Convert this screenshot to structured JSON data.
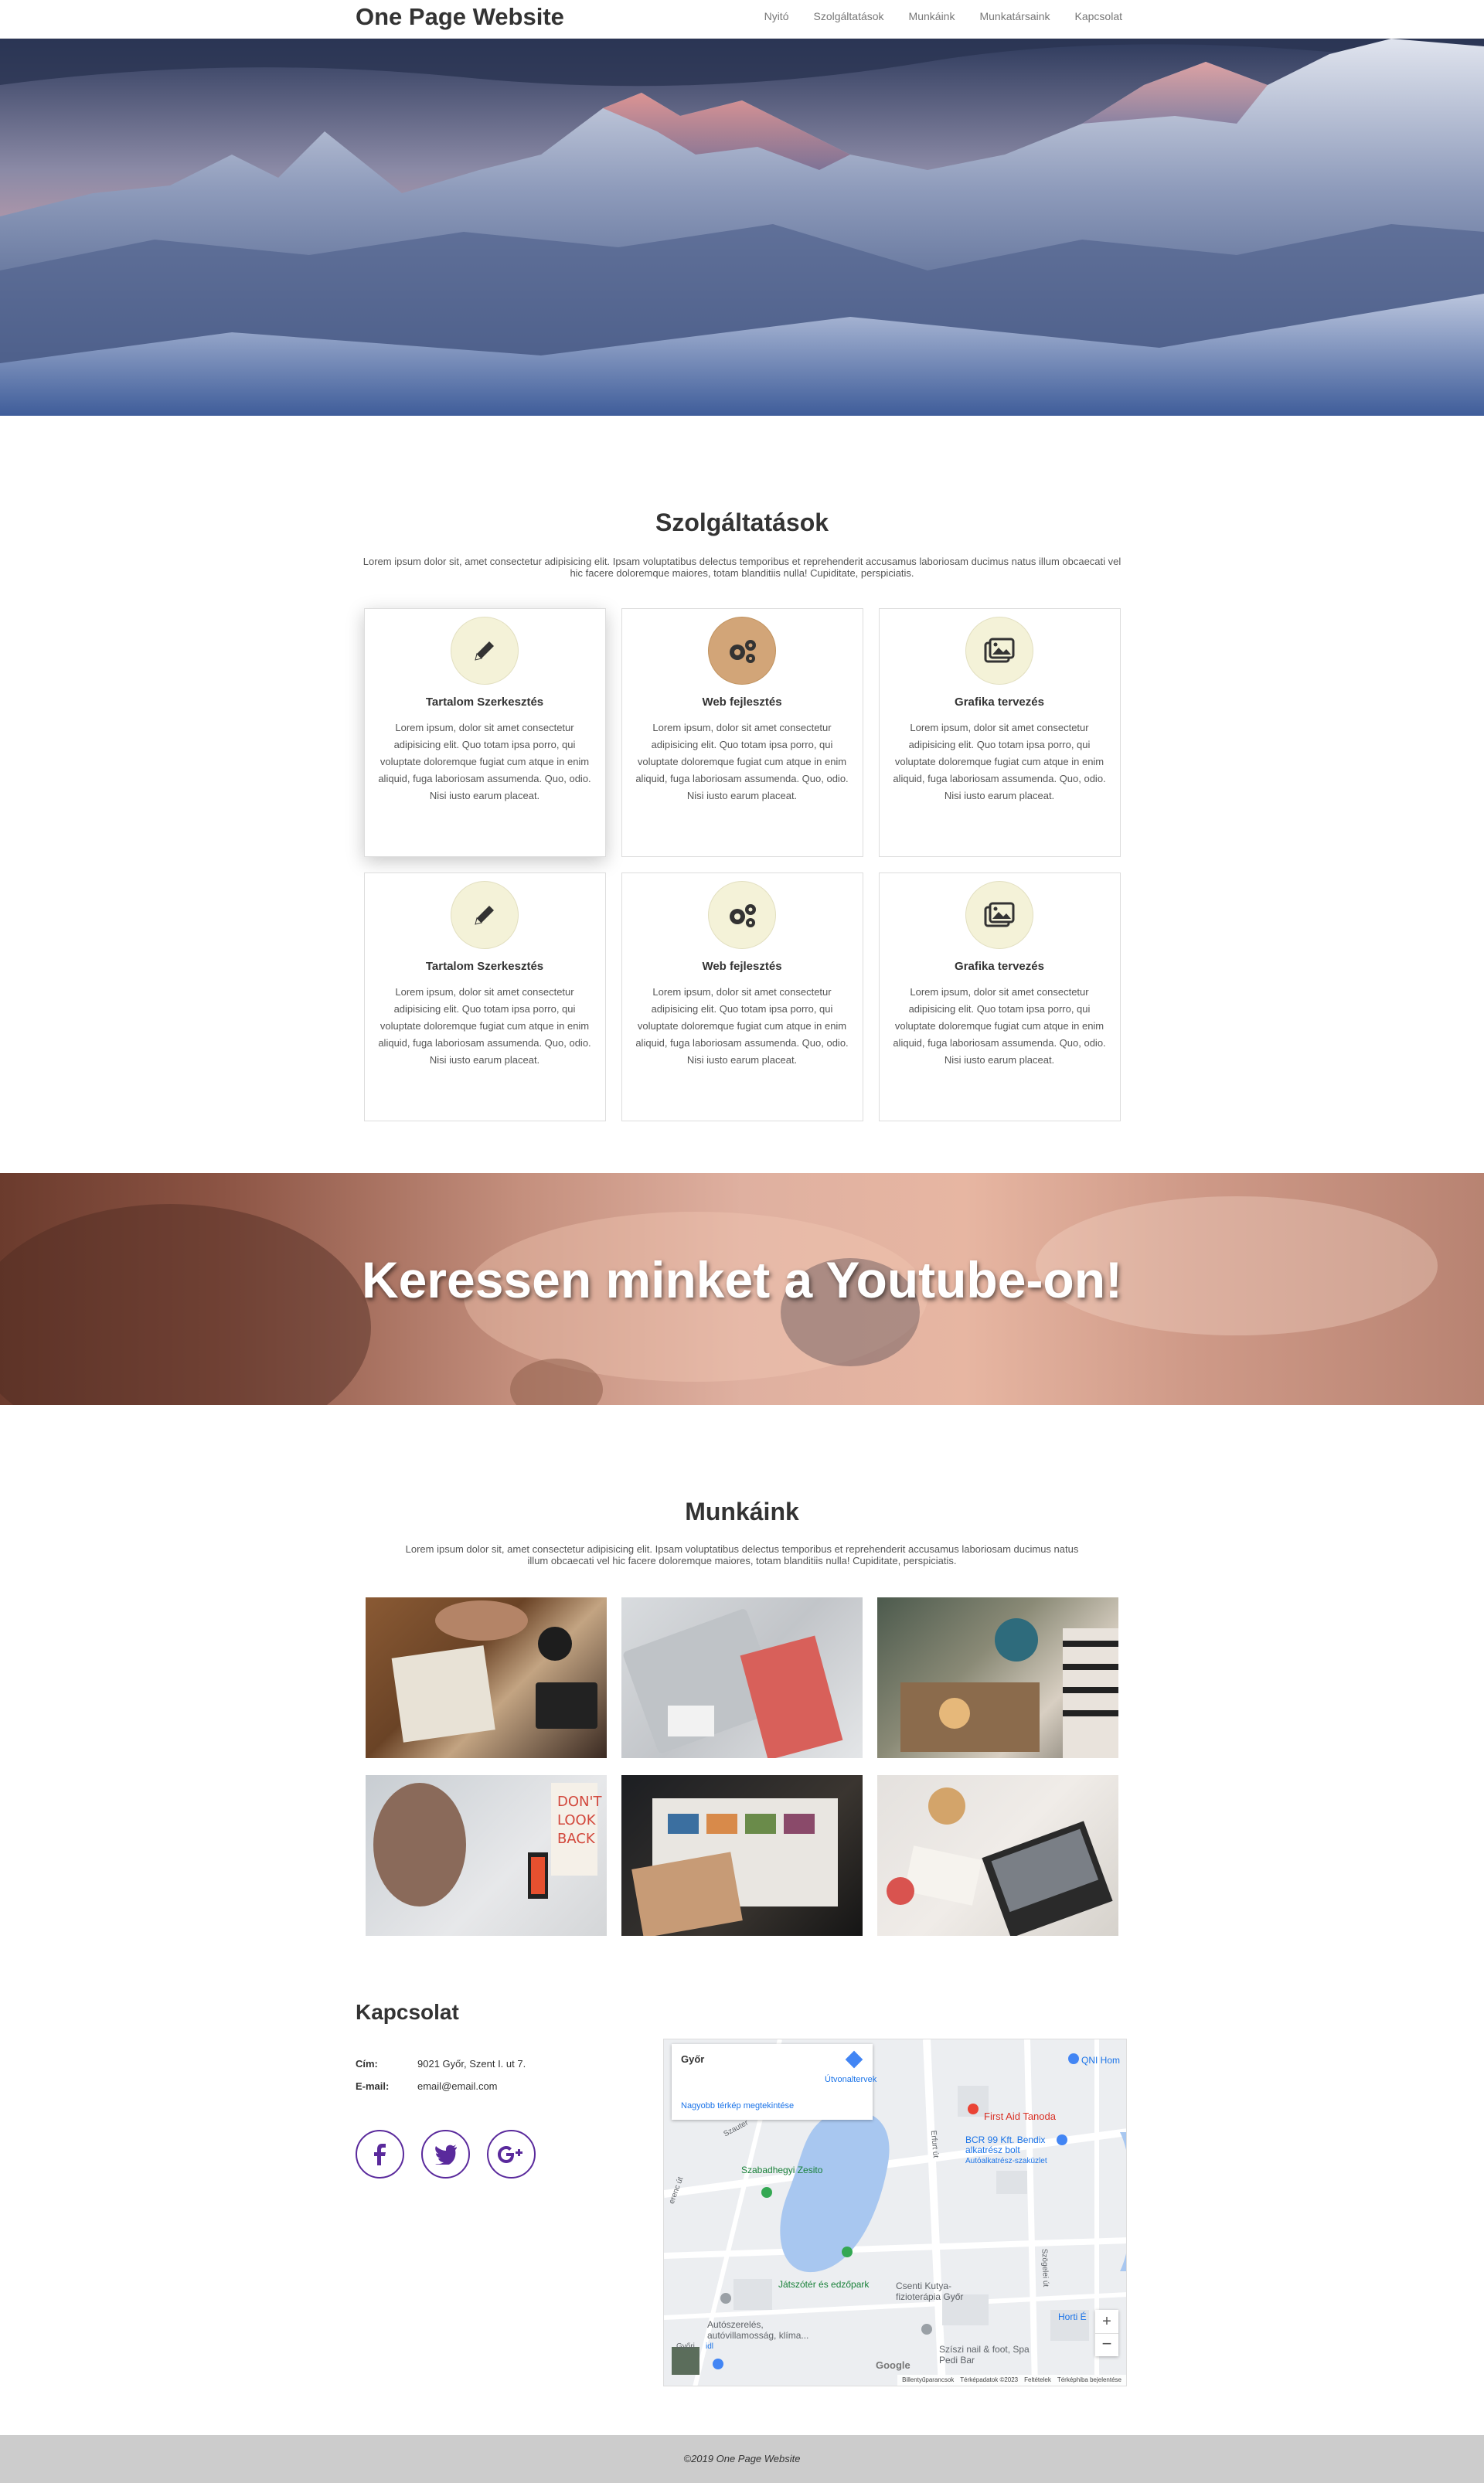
{
  "nav": {
    "brand": "One Page Website",
    "items": [
      "Nyitó",
      "Szolgáltatások",
      "Munkáink",
      "Munkatársaink",
      "Kapcsolat"
    ]
  },
  "services": {
    "title": "Szolgáltatások",
    "subtitle": "Lorem ipsum dolor sit, amet consectetur adipisicing elit. Ipsam voluptatibus delectus temporibus et reprehenderit accusamus laboriosam ducimus natus illum obcaecati vel hic facere doloremque maiores, totam blanditiis nulla! Cupiditate, perspiciatis.",
    "cards": [
      {
        "icon": "pencil-icon",
        "title": "Tartalom Szerkesztés",
        "text": "Lorem ipsum, dolor sit amet consectetur adipisicing elit. Quo totam ipsa porro, qui voluptate doloremque fugiat cum atque in enim aliquid, fuga laboriosam assumenda. Quo, odio. Nisi iusto earum placeat."
      },
      {
        "icon": "gears-icon",
        "title": "Web fejlesztés",
        "text": "Lorem ipsum, dolor sit amet consectetur adipisicing elit. Quo totam ipsa porro, qui voluptate doloremque fugiat cum atque in enim aliquid, fuga laboriosam assumenda. Quo, odio. Nisi iusto earum placeat."
      },
      {
        "icon": "images-icon",
        "title": "Grafika tervezés",
        "text": "Lorem ipsum, dolor sit amet consectetur adipisicing elit. Quo totam ipsa porro, qui voluptate doloremque fugiat cum atque in enim aliquid, fuga laboriosam assumenda. Quo, odio. Nisi iusto earum placeat."
      },
      {
        "icon": "pencil-icon",
        "title": "Tartalom Szerkesztés",
        "text": "Lorem ipsum, dolor sit amet consectetur adipisicing elit. Quo totam ipsa porro, qui voluptate doloremque fugiat cum atque in enim aliquid, fuga laboriosam assumenda. Quo, odio. Nisi iusto earum placeat."
      },
      {
        "icon": "gears-icon",
        "title": "Web fejlesztés",
        "text": "Lorem ipsum, dolor sit amet consectetur adipisicing elit. Quo totam ipsa porro, qui voluptate doloremque fugiat cum atque in enim aliquid, fuga laboriosam assumenda. Quo, odio. Nisi iusto earum placeat."
      },
      {
        "icon": "images-icon",
        "title": "Grafika tervezés",
        "text": "Lorem ipsum, dolor sit amet consectetur adipisicing elit. Quo totam ipsa porro, qui voluptate doloremque fugiat cum atque in enim aliquid, fuga laboriosam assumenda. Quo, odio. Nisi iusto earum placeat."
      }
    ]
  },
  "youtube": {
    "title": "Keressen minket a Youtube-on!"
  },
  "works": {
    "title": "Munkáink",
    "subtitle": "Lorem ipsum dolor sit, amet consectetur adipisicing elit. Ipsam voluptatibus delectus temporibus et reprehenderit accusamus laboriosam ducimus natus illum obcaecati vel hic facere doloremque maiores, totam blanditiis nulla! Cupiditate, perspiciatis.",
    "photos": [
      "notebook-desk-photo",
      "laptop-book-photo",
      "coffee-globe-photo",
      "designer-wall-photo",
      "photos-screen-photo",
      "laptop-desk-photo"
    ]
  },
  "contact": {
    "title": "Kapcsolat",
    "address_label": "Cím:",
    "address": "9021 Győr, Szent I. ut 7.",
    "email_label": "E-mail:",
    "email": "email@email.com",
    "social": [
      "facebook-icon",
      "twitter-icon",
      "google-plus-icon"
    ]
  },
  "map": {
    "place": "Győr",
    "directions": "Útvonaltervek",
    "larger_map": "Nagyobb térkép megtekintése",
    "labels": [
      "First Aid Tanoda",
      "BCR 99 Kft. Bendix alkatrész bolt",
      "Autóalkatrész-szaküzlet",
      "Szabadhegyi Zesito",
      "Játszótér és edzőpark",
      "Csenti Kutya-fizioterápia Győr",
      "Autószerelés, autóvillamosság, klíma...",
      "Szíszi nail & foot, Spa Pedi Bar",
      "QNI Hom",
      "Horti É",
      "Szauter",
      "Erfurt út",
      "Szögelei út",
      "erenc út",
      "Győri",
      "idl"
    ],
    "footer_items": [
      "Billentyűparancsok",
      "Térképadatok ©2023",
      "Feltételek",
      "Térképhiba bejelentése"
    ],
    "google": "Google"
  },
  "footer": {
    "text": "©2019 One Page Website"
  }
}
